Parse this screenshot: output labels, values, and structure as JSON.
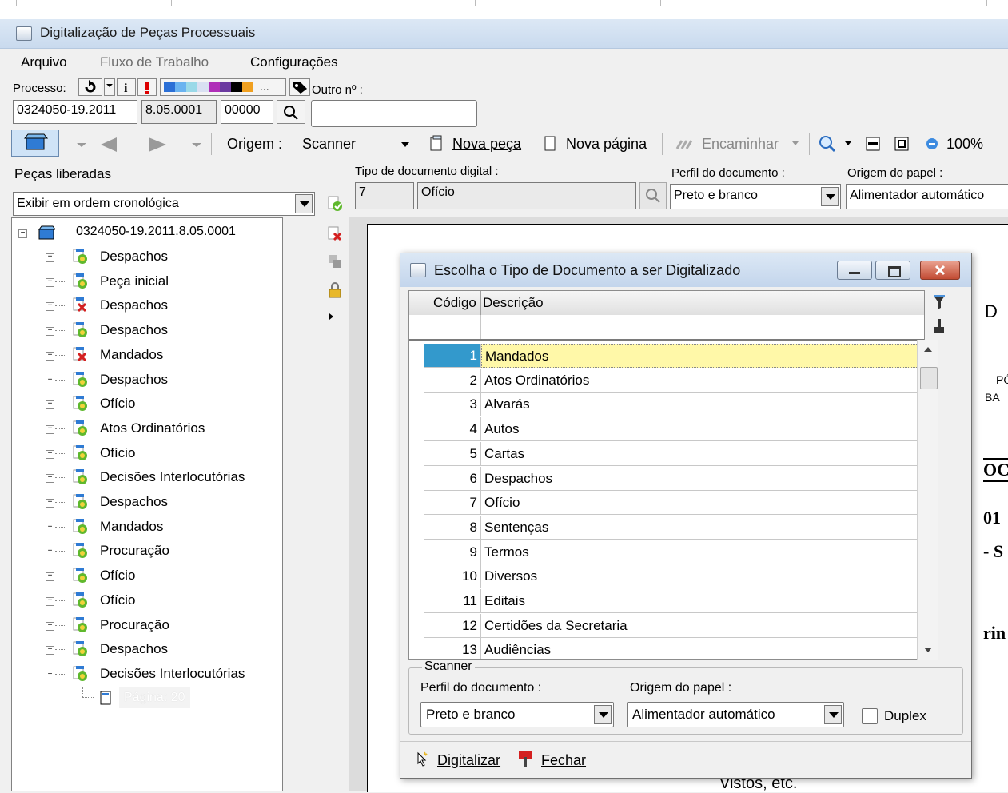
{
  "window": {
    "title": "Digitalização de Peças Processuais"
  },
  "menu": {
    "arquivo": "Arquivo",
    "fluxo": "Fluxo de Trabalho",
    "config": "Configurações"
  },
  "processo": {
    "label": "Processo:",
    "outro_label": "Outro nº :",
    "more": "...",
    "num1": "0324050-19.2011",
    "num2": "8.05.0001",
    "num3": "00000",
    "outro_value": ""
  },
  "toolbar": {
    "origem_label": "Origem :",
    "origem_value": "Scanner",
    "nova_peca": "Nova peça",
    "nova_pagina": "Nova página",
    "encaminhar": "Encaminhar",
    "zoom": "100%"
  },
  "left": {
    "header": "Peças liberadas",
    "order": "Exibir em ordem cronológica",
    "root": "0324050-19.2011.8.05.0001",
    "items": [
      {
        "label": "Despachos",
        "status": "ok"
      },
      {
        "label": "Peça inicial",
        "status": "ok"
      },
      {
        "label": "Despachos",
        "status": "err"
      },
      {
        "label": "Despachos",
        "status": "ok"
      },
      {
        "label": "Mandados",
        "status": "err"
      },
      {
        "label": "Despachos",
        "status": "ok"
      },
      {
        "label": "Ofício",
        "status": "ok"
      },
      {
        "label": "Atos Ordinatórios",
        "status": "ok"
      },
      {
        "label": "Ofício",
        "status": "ok"
      },
      {
        "label": "Decisões Interlocutórias",
        "status": "ok"
      },
      {
        "label": "Despachos",
        "status": "ok"
      },
      {
        "label": "Mandados",
        "status": "ok"
      },
      {
        "label": "Procuração",
        "status": "ok"
      },
      {
        "label": "Ofício",
        "status": "ok"
      },
      {
        "label": "Ofício",
        "status": "ok"
      },
      {
        "label": "Procuração",
        "status": "ok"
      },
      {
        "label": "Despachos",
        "status": "ok"
      },
      {
        "label": "Decisões Interlocutórias",
        "status": "ok"
      }
    ],
    "page_item": "Página: 20"
  },
  "doc": {
    "tipo_label": "Tipo de documento digital :",
    "tipo_code": "7",
    "tipo_name": "Ofício",
    "perfil_label": "Perfil do documento :",
    "perfil_value": "Preto e branco",
    "origem_label": "Origem do papel :",
    "origem_value": "Alimentador automático",
    "preview": {
      "t1": "D",
      "t2": "PÓ",
      "t3": "BA",
      "t4": "OC",
      "t5": "01",
      "t6": "- S",
      "t7": "rin",
      "t8": "Vistos, etc."
    }
  },
  "dialog": {
    "title": "Escolha o Tipo de Documento a ser Digitalizado",
    "col_code": "Código",
    "col_desc": "Descrição",
    "rows": [
      {
        "code": "1",
        "desc": "Mandados"
      },
      {
        "code": "2",
        "desc": "Atos Ordinatórios"
      },
      {
        "code": "3",
        "desc": "Alvarás"
      },
      {
        "code": "4",
        "desc": "Autos"
      },
      {
        "code": "5",
        "desc": "Cartas"
      },
      {
        "code": "6",
        "desc": "Despachos"
      },
      {
        "code": "7",
        "desc": "Ofício"
      },
      {
        "code": "8",
        "desc": "Sentenças"
      },
      {
        "code": "9",
        "desc": "Termos"
      },
      {
        "code": "10",
        "desc": "Diversos"
      },
      {
        "code": "11",
        "desc": "Editais"
      },
      {
        "code": "12",
        "desc": "Certidões da Secretaria"
      },
      {
        "code": "13",
        "desc": "Audiências"
      }
    ],
    "scanner_group": "Scanner",
    "perfil_label": "Perfil do documento :",
    "perfil_value": "Preto e branco",
    "origem_label": "Origem do papel :",
    "origem_value": "Alimentador automático",
    "duplex": "Duplex",
    "digitalizar": "Digitalizar",
    "fechar": "Fechar"
  }
}
